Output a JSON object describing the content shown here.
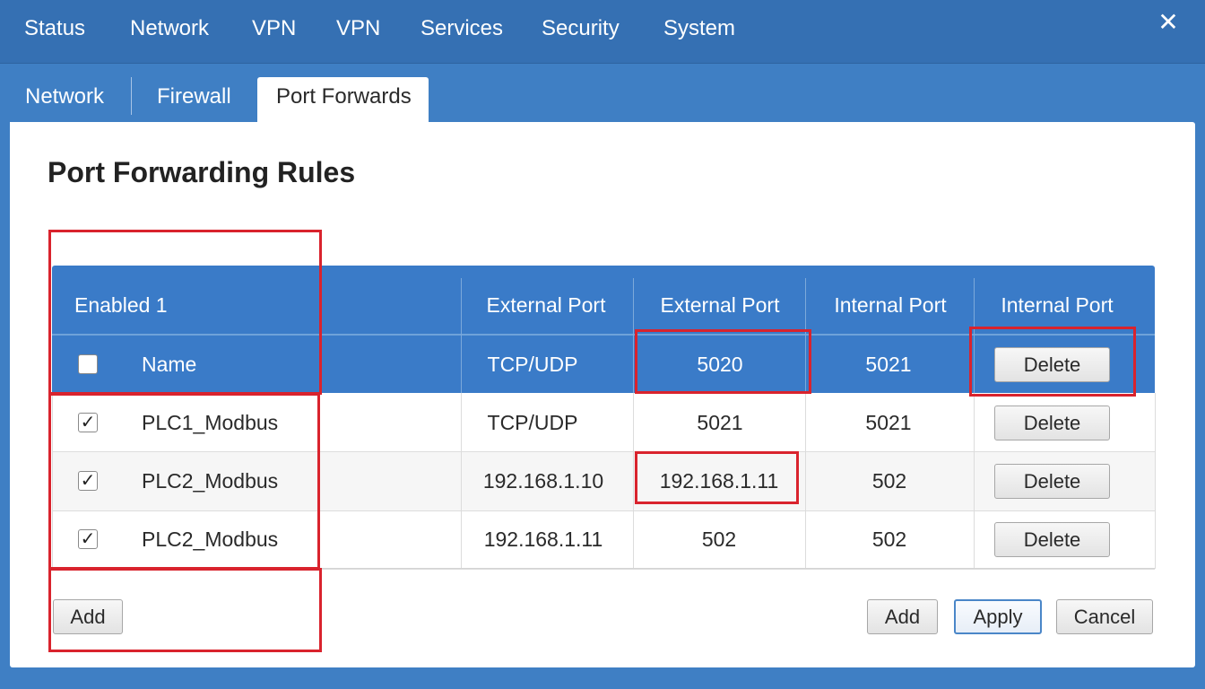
{
  "topnav": {
    "items": [
      {
        "label": "Status"
      },
      {
        "label": "Network"
      },
      {
        "label": "VPN"
      },
      {
        "label": "VPN"
      },
      {
        "label": "Services"
      },
      {
        "label": "Security"
      },
      {
        "label": "System"
      }
    ],
    "close_icon": "✕"
  },
  "subtabs": {
    "items": [
      {
        "label": "Network"
      },
      {
        "label": "Firewall"
      },
      {
        "label": "Port Forwards",
        "active": true
      }
    ]
  },
  "panel": {
    "title": "Port Forwarding Rules"
  },
  "table": {
    "header_row1": {
      "enabled": "Enabled 1",
      "col3": "External Port",
      "col4": "External Port",
      "col5": "Internal Port",
      "col6": "Internal Port"
    },
    "header_row2": {
      "checked": false,
      "name": "Name",
      "protocol": "TCP/UDP",
      "external_port": "5020",
      "internal_port": "5021",
      "action": "Delete"
    },
    "rows": [
      {
        "checked": true,
        "name": "PLC1_Modbus",
        "col3": "TCP/UDP",
        "col4": "5021",
        "col5": "5021",
        "action": "Delete"
      },
      {
        "checked": true,
        "name": "PLC2_Modbus",
        "col3": "192.168.1.10",
        "col4": "192.168.1.11",
        "col5": "502",
        "action": "Delete"
      },
      {
        "checked": true,
        "name": "PLC2_Modbus",
        "col3": "192.168.1.11",
        "col4": "502",
        "col5": "502",
        "action": "Delete"
      }
    ]
  },
  "footer": {
    "add_left": "Add",
    "add_right": "Add",
    "apply": "Apply",
    "cancel": "Cancel"
  },
  "colors": {
    "topbar": "#3570b3",
    "background": "#3f7fc4",
    "table_header": "#3a7bc8",
    "highlight": "#d9232d"
  }
}
